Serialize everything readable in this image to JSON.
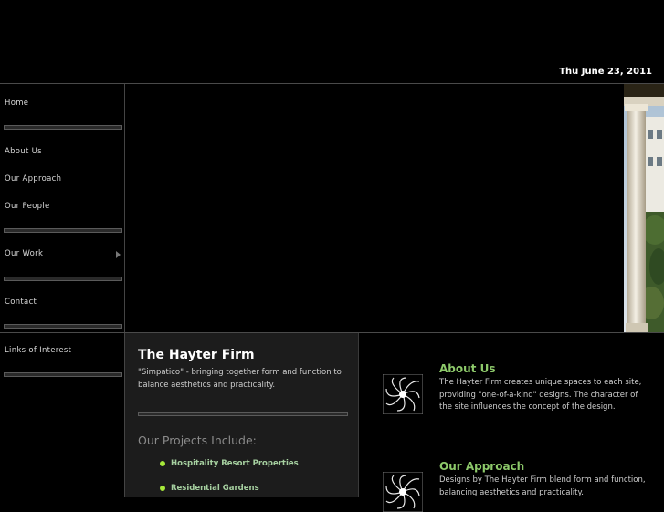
{
  "header": {
    "date": "Thu June 23, 2011"
  },
  "nav": {
    "home": "Home",
    "about": "About Us",
    "approach": "Our Approach",
    "people": "Our People",
    "work": "Our Work",
    "contact": "Contact",
    "links": "Links of Interest"
  },
  "intro": {
    "title": "The Hayter Firm",
    "slogan": "\"Simpatico\" - bringing together form and function to balance aesthetics and practicality.",
    "projects_heading": "Our Projects Include:",
    "projects": [
      "Hospitality Resort Properties",
      "Residential Gardens"
    ]
  },
  "sections": {
    "about": {
      "title": "About Us",
      "text": "The Hayter Firm creates unique spaces to each site, providing \"one-of-a-kind\" designs. The character of the site influences the concept of the design."
    },
    "approach": {
      "title": "Our Approach",
      "text": "Designs by The Hayter Firm blend form and function, balancing aesthetics and practicality."
    }
  },
  "colors": {
    "accent_green": "#8dc96a",
    "bullet_green": "#a6e83a",
    "background": "#000000"
  }
}
